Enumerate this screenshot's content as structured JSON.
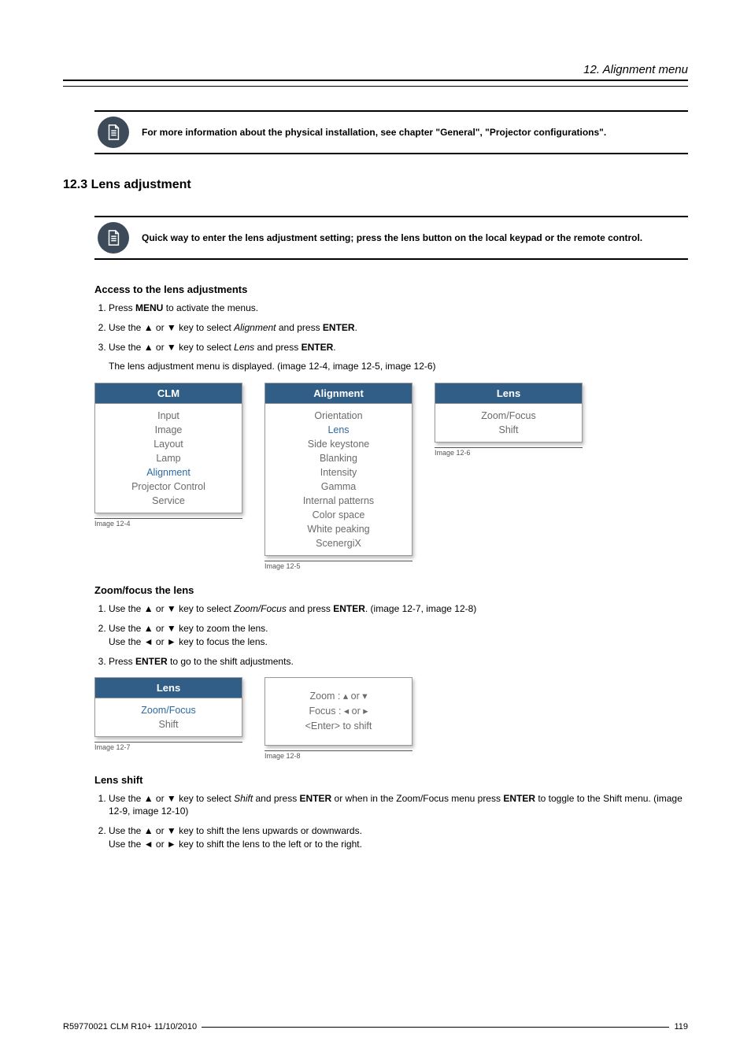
{
  "header": {
    "chapter": "12.  Alignment menu"
  },
  "callout1": {
    "text": "For more information about the physical installation, see chapter \"General\", \"Projector configurations\"."
  },
  "section": {
    "number_title": "12.3  Lens adjustment"
  },
  "callout2": {
    "text": "Quick way to enter the lens adjustment setting; press the lens button on the local keypad or the remote control."
  },
  "access": {
    "heading": "Access to the lens adjustments",
    "steps": [
      {
        "pre": "Press ",
        "b1": "MENU",
        "post": " to activate the menus."
      },
      {
        "pre": "Use the ▲ or ▼ key to select ",
        "it": "Alignment",
        "mid": " and press ",
        "b1": "ENTER",
        "post": "."
      },
      {
        "pre": "Use the ▲ or ▼ key to select ",
        "it": "Lens",
        "mid": " and press ",
        "b1": "ENTER",
        "post": "."
      }
    ],
    "note": "The lens adjustment menu is displayed. (image 12-4, image 12-5, image 12-6)"
  },
  "menus": {
    "clm": {
      "title": "CLM",
      "items": [
        "Input",
        "Image",
        "Layout",
        "Lamp",
        "Alignment",
        "Projector Control",
        "Service"
      ],
      "selected_index": 4,
      "label": "Image 12-4"
    },
    "alignment": {
      "title": "Alignment",
      "items": [
        "Orientation",
        "Lens",
        "Side keystone",
        "Blanking",
        "Intensity",
        "Gamma",
        "Internal patterns",
        "Color space",
        "White peaking",
        "ScenergiX"
      ],
      "selected_index": 1,
      "label": "Image 12-5"
    },
    "lens": {
      "title": "Lens",
      "items": [
        "Zoom/Focus",
        "Shift"
      ],
      "selected_index": -1,
      "label": "Image 12-6"
    }
  },
  "zoom": {
    "heading": "Zoom/focus the lens",
    "steps": {
      "s1": {
        "pre": "Use the ▲ or ▼ key to select ",
        "it": "Zoom/Focus",
        "mid": " and press ",
        "b1": "ENTER",
        "post": ". (image 12-7, image 12-8)"
      },
      "s2a": "Use the ▲ or ▼ key to zoom the lens.",
      "s2b": "Use the ◄ or ► key to focus the lens.",
      "s3": {
        "pre": "Press ",
        "b1": "ENTER",
        "post": " to go to the shift adjustments."
      }
    },
    "menu_lens2": {
      "title": "Lens",
      "items": [
        "Zoom/Focus",
        "Shift"
      ],
      "selected_index": 0,
      "label": "Image 12-7"
    },
    "zoom_box": {
      "line1": "Zoom : ▴ or ▾",
      "line2": "Focus : ◂ or ▸",
      "line3": "<Enter> to shift",
      "label": "Image 12-8"
    }
  },
  "shift": {
    "heading": "Lens shift",
    "steps": {
      "s1": {
        "pre": "Use the ▲ or ▼ key to select ",
        "it": "Shift",
        "mid": " and press ",
        "b1": "ENTER",
        "mid2": " or when in the Zoom/Focus menu press ",
        "b2": "ENTER",
        "post": " to toggle to the Shift menu. (image 12-9, image 12-10)"
      },
      "s2a": "Use the ▲ or ▼ key to shift the lens upwards or downwards.",
      "s2b": "Use the ◄ or ► key to shift the lens to the left or to the right."
    }
  },
  "footer": {
    "left": "R59770021  CLM R10+  11/10/2010",
    "right": "119"
  }
}
